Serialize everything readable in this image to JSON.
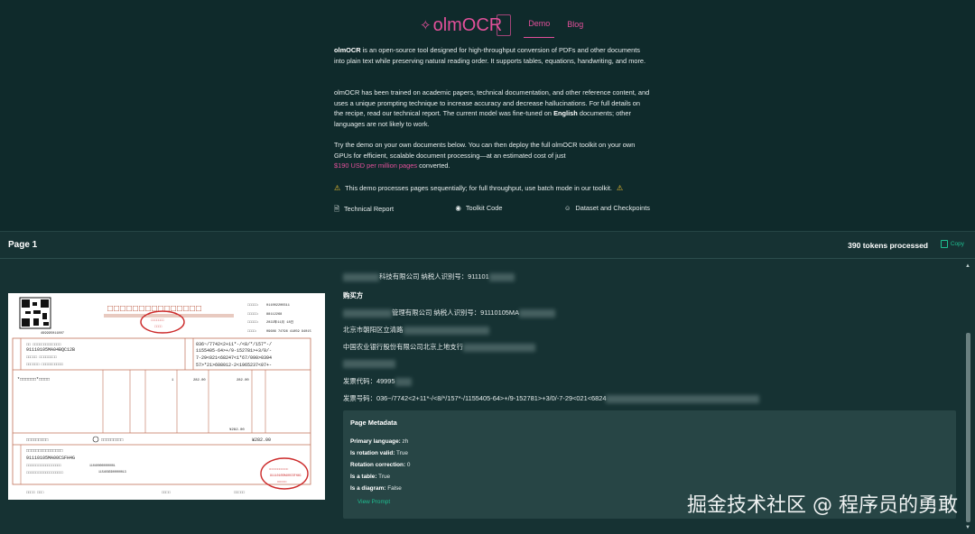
{
  "nav": {
    "logo": "olmOCR",
    "demo": "Demo",
    "blog": "Blog"
  },
  "intro": {
    "p1_bold": "olmOCR",
    "p1_rest": " is an open-source tool designed for high-throughput conversion of PDFs and other documents into plain text while preserving natural reading order. It supports tables, equations, handwriting, and more.",
    "p2_a": "olmOCR has been trained on academic papers, technical documentation, and other reference content, and uses a unique prompting technique to increase accuracy and decrease hallucinations. For full details on the recipe, read our technical report. The current model was fine-tuned on ",
    "p2_bold": "English",
    "p2_b": " documents; other languages are not likely to work.",
    "p3_a": "Try the demo on your own documents below. You can then deploy the full olmOCR toolkit on your own GPUs for efficient, scalable document processing—at an estimated cost of just",
    "p3_price": "$190 USD per million pages",
    "p3_b": " converted.",
    "warning": "This demo processes pages sequentially; for full throughput, use batch mode in our toolkit."
  },
  "links": {
    "report": "Technical Report",
    "code": "Toolkit Code",
    "dataset": "Dataset and Checkpoints"
  },
  "page": {
    "title": "Page 1",
    "tokens": "390 tokens processed",
    "copy": "Copy"
  },
  "output_lines": [
    "科技有限公司 纳税人识别号：911101",
    "购买方",
    "管理有限公司 纳税人识别号：91110105MA",
    "北京市朝阳区立清路",
    "中国农业银行股份有限公司北京上地支行",
    "",
    "发票代码：49995",
    "发票号码：036~/7742<2+11*-/<8/*/157*-/1155405-64>+/9-152781>+3/0/-7-29<021<6824"
  ],
  "meta": {
    "title": "Page Metadata",
    "lang_label": "Primary language:",
    "lang_value": "zh",
    "rot_label": "Is rotation valid:",
    "rot_value": "True",
    "corr_label": "Rotation correction:",
    "corr_value": "0",
    "table_label": "Is a table:",
    "table_value": "True",
    "diagram_label": "Is a diagram:",
    "diagram_value": "False",
    "view_prompt": "View Prompt"
  },
  "invoice": {
    "qr_code_text": "499995011807",
    "num1": "011002200311",
    "num2": "88112268",
    "date": "2022年11月 18日",
    "check": "09686 74796 41859 94015",
    "buyer_id": "91110105MA04BQC12B",
    "cipher1": "036~/7742<2+11*-/<8/*/157*-/",
    "cipher2": "1155405-64>+/9-152781>+3/0/-",
    "cipher3": "7-29<021<68247<1*67/090>0394",
    "cipher4": "57>*21>608012-2<1965237<07+-",
    "qty": "1",
    "price": "282.00",
    "amount": "282.00",
    "tax_total": "¥282.00",
    "total": "¥282.00",
    "seller_id": "91110105MA00CSFH4G",
    "seller_bank": "110400000000001",
    "seller_acct": "1154030300000013"
  },
  "watermark": "掘金技术社区 @ 程序员的勇敢"
}
